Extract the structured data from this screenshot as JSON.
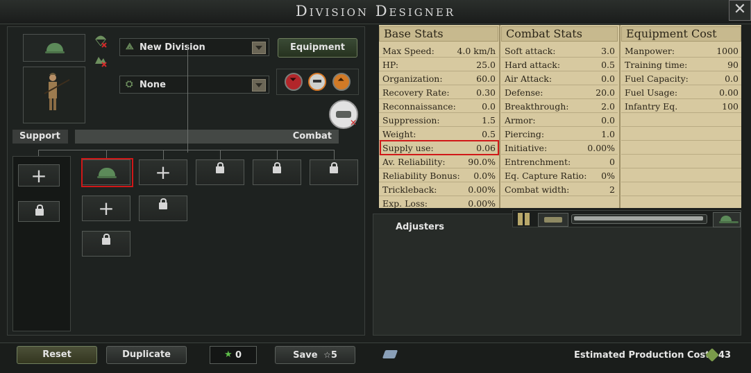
{
  "window": {
    "title": "Division Designer"
  },
  "header": {
    "division_name": "New Division",
    "template_type": "None",
    "equipment_label": "Equipment"
  },
  "sections": {
    "support_label": "Support",
    "combat_label": "Combat"
  },
  "stats": {
    "base": {
      "title": "Base Stats",
      "rows": [
        {
          "label": "Max Speed:",
          "value": "4.0 km/h"
        },
        {
          "label": "HP:",
          "value": "25.0"
        },
        {
          "label": "Organization:",
          "value": "60.0"
        },
        {
          "label": "Recovery Rate:",
          "value": "0.30"
        },
        {
          "label": "Reconnaissance:",
          "value": "0.0"
        },
        {
          "label": "Suppression:",
          "value": "1.5"
        },
        {
          "label": "Weight:",
          "value": "0.5"
        },
        {
          "label": "Supply use:",
          "value": "0.06"
        },
        {
          "label": "Av. Reliability:",
          "value": "90.0%"
        },
        {
          "label": "Reliability Bonus:",
          "value": "0.0%"
        },
        {
          "label": "Trickleback:",
          "value": "0.00%"
        },
        {
          "label": "Exp. Loss:",
          "value": "0.00%"
        }
      ]
    },
    "combat": {
      "title": "Combat Stats",
      "rows": [
        {
          "label": "Soft attack:",
          "value": "3.0"
        },
        {
          "label": "Hard attack:",
          "value": "0.5"
        },
        {
          "label": "Air Attack:",
          "value": "0.0"
        },
        {
          "label": "Defense:",
          "value": "20.0"
        },
        {
          "label": "Breakthrough:",
          "value": "2.0"
        },
        {
          "label": "Armor:",
          "value": "0.0"
        },
        {
          "label": "Piercing:",
          "value": "1.0"
        },
        {
          "label": "Initiative:",
          "value": "0.00%"
        },
        {
          "label": "Entrenchment:",
          "value": "0"
        },
        {
          "label": "Eq. Capture Ratio:",
          "value": "0%"
        },
        {
          "label": "Combat width:",
          "value": "2"
        }
      ]
    },
    "cost": {
      "title": "Equipment Cost",
      "rows": [
        {
          "label": "Manpower:",
          "value": "1000"
        },
        {
          "label": "Training time:",
          "value": "90"
        },
        {
          "label": "Fuel Capacity:",
          "value": "0.0"
        },
        {
          "label": "Fuel Usage:",
          "value": "0.00"
        },
        {
          "label": "Infantry Eq.",
          "value": "100"
        }
      ]
    }
  },
  "adjusters": {
    "label": "Adjusters"
  },
  "footer": {
    "reset_label": "Reset",
    "duplicate_label": "Duplicate",
    "xp_value": "0",
    "save_label": "Save",
    "save_cost": "5",
    "production_label": "Estimated Production Cost:",
    "production_value": "43"
  },
  "colors": {
    "highlight": "#d01818",
    "parchment": "#d7c9a0",
    "unit_green": "#5c8a59"
  },
  "icons": [
    "close-icon",
    "helmet-icon",
    "parachute-icon",
    "infantry-portrait",
    "lock-icon",
    "plus-icon",
    "tank-icon",
    "star-icon",
    "chevron-down-icon",
    "chevron-up-icon"
  ]
}
